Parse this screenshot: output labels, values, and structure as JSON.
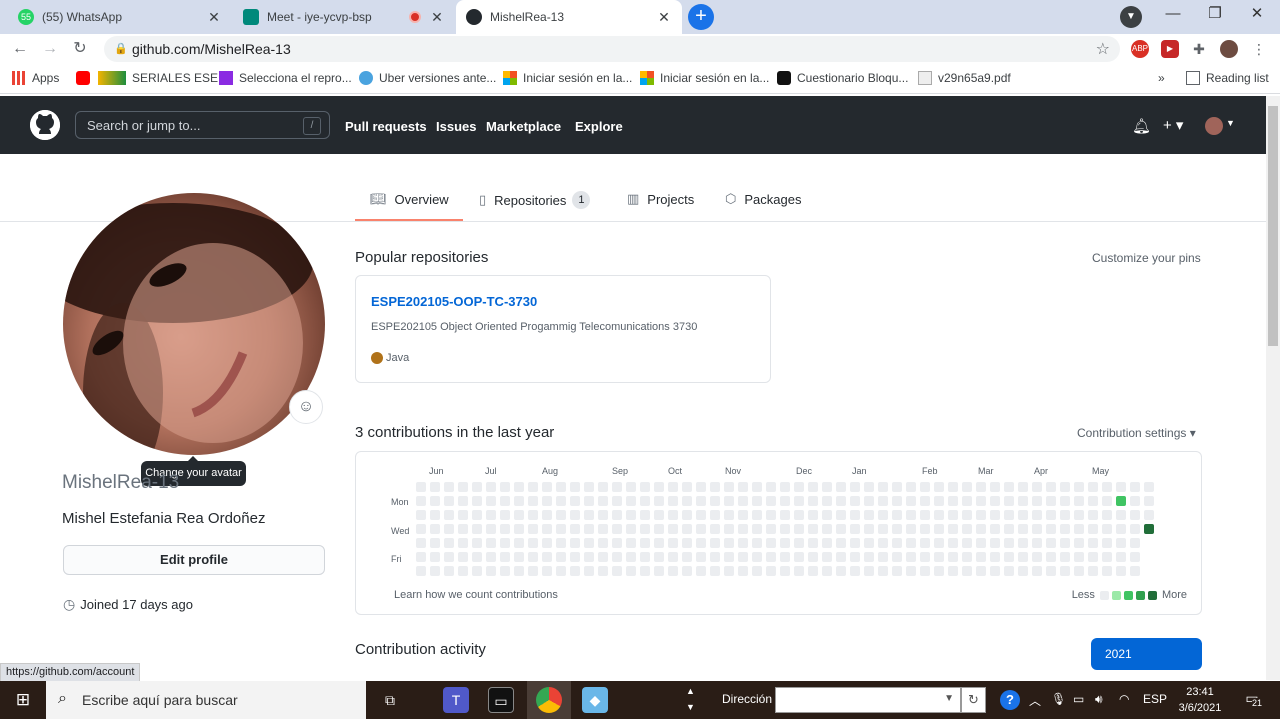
{
  "browser": {
    "tabs": [
      {
        "title": "(55) WhatsApp",
        "icon": "whatsapp-icon",
        "color": "#25d366",
        "badge": "55"
      },
      {
        "title": "Meet - iye-ycvp-bsp",
        "icon": "meet-icon",
        "color": "#00897b"
      },
      {
        "title": "MishelRea-13",
        "icon": "github-icon",
        "color": "#24292e"
      }
    ],
    "url": "github.com/MishelRea-13",
    "bookmarks": [
      {
        "label": "Apps",
        "color": "#ea4335"
      },
      {
        "label": "",
        "color": "#ff0000"
      },
      {
        "label": "SERIALES ESE...",
        "color": "#1e8e3e"
      },
      {
        "label": "Selecciona el repro...",
        "color": "#8a2be2"
      },
      {
        "label": "Uber versiones ante...",
        "color": "#4aa3df"
      },
      {
        "label": "Iniciar sesión en la...",
        "color": "#f25022"
      },
      {
        "label": "Iniciar sesión en la...",
        "color": "#f25022"
      },
      {
        "label": "Cuestionario Bloqu...",
        "color": "#111111"
      },
      {
        "label": "v29n65a9.pdf",
        "color": "#888888"
      }
    ],
    "bookmarks_overflow": "»",
    "reading_list": "Reading list",
    "status_url": "https://github.com/account"
  },
  "github": {
    "search_placeholder": "Search or jump to...",
    "search_key": "/",
    "nav": [
      "Pull requests",
      "Issues",
      "Marketplace",
      "Explore"
    ],
    "plus": "+ ▾",
    "profile_tabs": [
      {
        "label": "Overview",
        "icon": "book-icon"
      },
      {
        "label": "Repositories",
        "icon": "repo-icon",
        "count": "1"
      },
      {
        "label": "Projects",
        "icon": "project-icon"
      },
      {
        "label": "Packages",
        "icon": "package-icon"
      }
    ],
    "tooltip": "Change your avatar",
    "username": "MishelRea-13",
    "fullname": "Mishel Estefania Rea Ordoñez",
    "edit_profile": "Edit profile",
    "joined": "Joined 17 days ago",
    "popular_title": "Popular repositories",
    "customize_pins": "Customize your pins",
    "repo": {
      "name": "ESPE202105-OOP-TC-3730",
      "description": "ESPE202105 Object Oriented Progammig Telecomunications 3730",
      "language": "Java",
      "language_color": "#b07219"
    },
    "contrib_title": "3 contributions in the last year",
    "contrib_settings": "Contribution settings ▾",
    "months": [
      "Jun",
      "Jul",
      "Aug",
      "Sep",
      "Oct",
      "Nov",
      "Dec",
      "Jan",
      "Feb",
      "Mar",
      "Apr",
      "May"
    ],
    "days": [
      "Mon",
      "Wed",
      "Fri"
    ],
    "learn": "Learn how we count contributions",
    "less": "Less",
    "more": "More",
    "legend_colors": [
      "#ebedf0",
      "#9be9a8",
      "#40c463",
      "#30a14e",
      "#216e39"
    ],
    "grid_weeks": 53,
    "contributions": [
      {
        "week": 50,
        "day": 1,
        "level": 2
      },
      {
        "week": 52,
        "day": 3,
        "level": 4
      }
    ],
    "activity_title": "Contribution activity",
    "year": "2021"
  },
  "taskbar": {
    "search": "Escribe aquí para buscar",
    "direccion": "Dirección",
    "lang": "ESP",
    "time": "23:41",
    "date": "3/6/2021",
    "notifications": "21"
  }
}
